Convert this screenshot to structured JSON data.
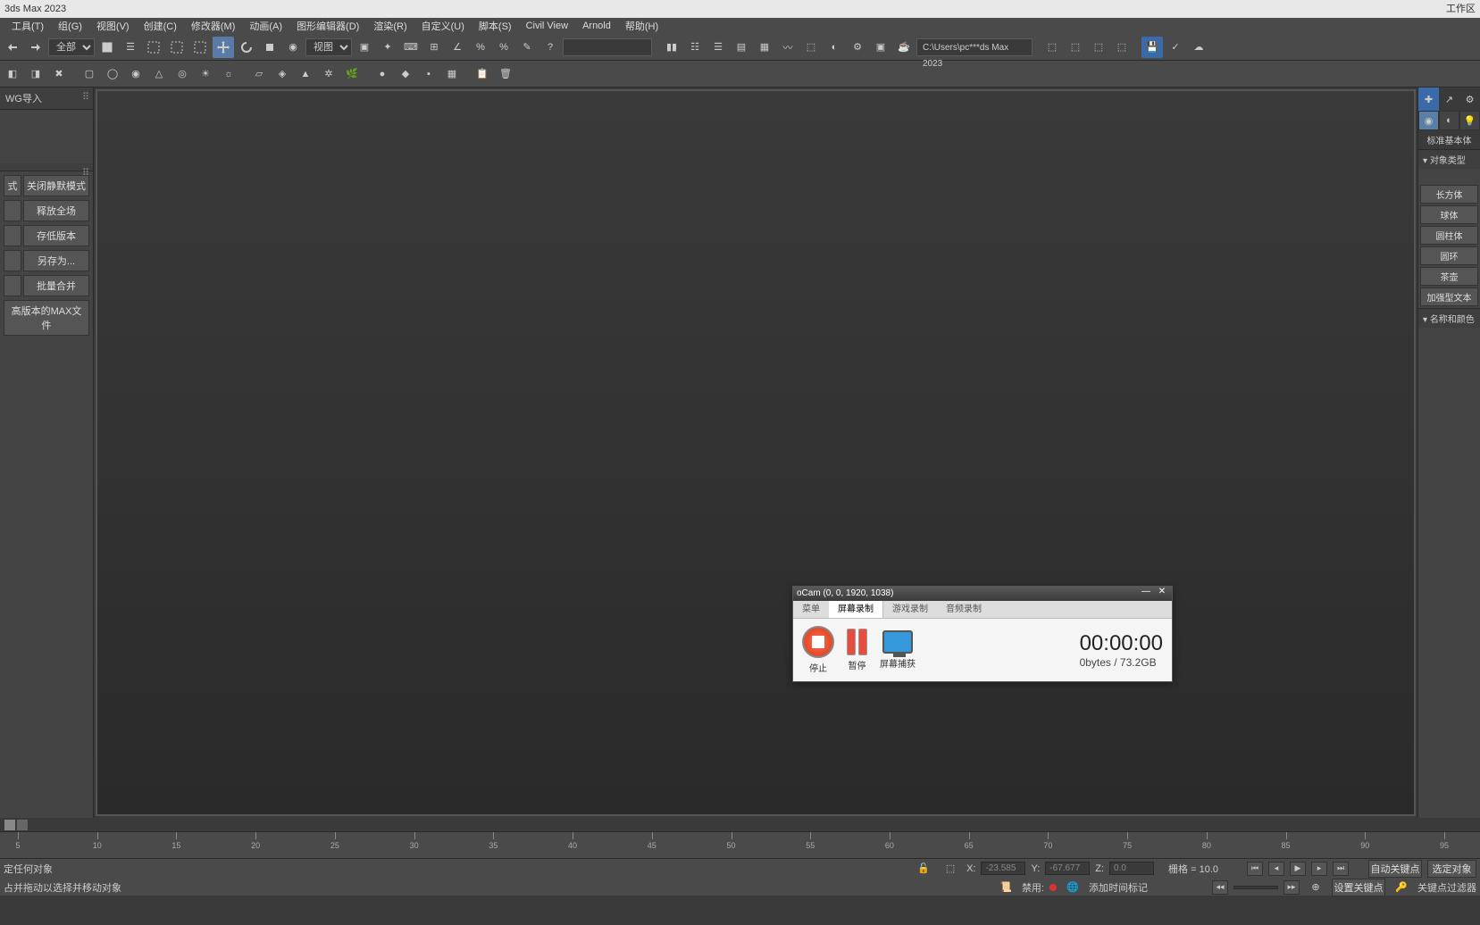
{
  "app": {
    "title": "3ds Max 2023",
    "workspace": "工作区"
  },
  "menus": [
    "工具(T)",
    "组(G)",
    "视图(V)",
    "创建(C)",
    "修改器(M)",
    "动画(A)",
    "图形编辑器(D)",
    "渲染(R)",
    "自定义(U)",
    "脚本(S)",
    "Civil View",
    "Arnold",
    "帮助(H)"
  ],
  "toolbar1": {
    "filter_dropdown": "全部",
    "view_dropdown": "视图",
    "path_field": "C:\\Users\\pc***ds Max 2023"
  },
  "left_panel": {
    "header": "WG导入",
    "buttons": [
      "关闭静默模式",
      "释放全场",
      "存低版本",
      "另存为...",
      "批量合并",
      "高版本的MAX文件"
    ],
    "partial_buttons": [
      "式",
      "",
      "",
      "",
      "",
      ""
    ]
  },
  "right_panel": {
    "category_label": "标准基本体",
    "section1": "对象类型",
    "primitives": [
      "长方体",
      "球体",
      "圆柱体",
      "圆环",
      "茶壶",
      "加强型文本"
    ],
    "section2": "名称和颜色"
  },
  "ruler": {
    "ticks": [
      5,
      10,
      15,
      20,
      25,
      30,
      35,
      40,
      45,
      50,
      55,
      60,
      65,
      70,
      75,
      80,
      85,
      90,
      95
    ]
  },
  "status": {
    "line1": "定任何对象",
    "line2": "占并拖动以选择并移动对象",
    "x_label": "X:",
    "x_val": "-23.585",
    "y_label": "Y:",
    "y_val": "-67.677",
    "z_label": "Z:",
    "z_val": "0.0",
    "grid": "栅格 = 10.0",
    "disable": "禁用:",
    "add_marker": "添加时间标记",
    "auto_key": "自动关键点",
    "sel_obj": "选定对象",
    "set_key": "设置关键点",
    "key_filter": "关键点过滤器"
  },
  "ocam": {
    "title": "oCam (0, 0, 1920, 1038)",
    "tabs": [
      "菜单",
      "屏幕录制",
      "游戏录制",
      "音频录制"
    ],
    "active_tab": 1,
    "stop": "停止",
    "pause": "暂停",
    "capture": "屏幕捕获",
    "time": "00:00:00",
    "size": "0bytes / 73.2GB"
  }
}
